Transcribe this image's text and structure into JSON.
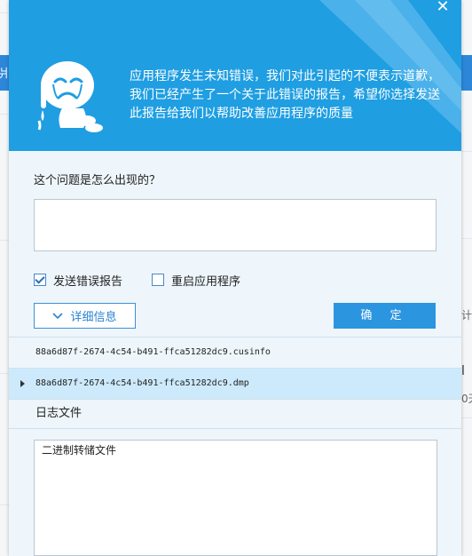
{
  "dialog": {
    "close_symbol": "✕",
    "header_message": "应用程序发生未知错误，我们对此引起的不便表示道歉，我们已经产生了一个关于此错误的报告，希望你选择发送此报告给我们以帮助改善应用程序的质量",
    "question_label": "这个问题是怎么出现的？",
    "question_value": "",
    "checkboxes": [
      {
        "label": "发送错误报告",
        "checked": true
      },
      {
        "label": "重启应用程序",
        "checked": false
      }
    ],
    "details_button": "详细信息",
    "ok_button": "确 定",
    "files": [
      {
        "name": "88a6d87f-2674-4c54-b491-ffca51282dc9.cusinfo",
        "selected": false
      },
      {
        "name": "88a6d87f-2674-4c54-b491-ffca51282dc9.dmp",
        "selected": true
      }
    ],
    "log_label": "日志文件",
    "dump_text": "二进制转储文件",
    "colors": {
      "header_bg": "#1f9ee2",
      "accent": "#2c95e0",
      "dialog_bg": "#eef6fb",
      "selected_row": "#cdeafc"
    },
    "icons": [
      "close-icon",
      "crying-mascot-icon",
      "check-icon",
      "chevron-down-icon",
      "expand-arrow-icon"
    ]
  },
  "background": {
    "left_fragment": "爿",
    "right_fragments": [
      "计",
      "l",
      "0天"
    ]
  }
}
